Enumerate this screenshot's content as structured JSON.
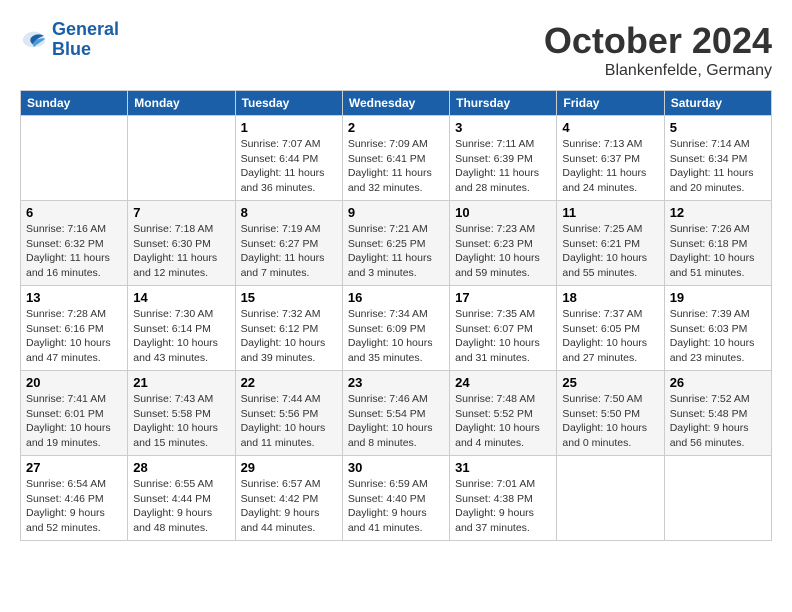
{
  "header": {
    "logo_line1": "General",
    "logo_line2": "Blue",
    "month": "October 2024",
    "location": "Blankenfelde, Germany"
  },
  "weekdays": [
    "Sunday",
    "Monday",
    "Tuesday",
    "Wednesday",
    "Thursday",
    "Friday",
    "Saturday"
  ],
  "weeks": [
    [
      {
        "day": "",
        "sunrise": "",
        "sunset": "",
        "daylight": ""
      },
      {
        "day": "",
        "sunrise": "",
        "sunset": "",
        "daylight": ""
      },
      {
        "day": "1",
        "sunrise": "Sunrise: 7:07 AM",
        "sunset": "Sunset: 6:44 PM",
        "daylight": "Daylight: 11 hours and 36 minutes."
      },
      {
        "day": "2",
        "sunrise": "Sunrise: 7:09 AM",
        "sunset": "Sunset: 6:41 PM",
        "daylight": "Daylight: 11 hours and 32 minutes."
      },
      {
        "day": "3",
        "sunrise": "Sunrise: 7:11 AM",
        "sunset": "Sunset: 6:39 PM",
        "daylight": "Daylight: 11 hours and 28 minutes."
      },
      {
        "day": "4",
        "sunrise": "Sunrise: 7:13 AM",
        "sunset": "Sunset: 6:37 PM",
        "daylight": "Daylight: 11 hours and 24 minutes."
      },
      {
        "day": "5",
        "sunrise": "Sunrise: 7:14 AM",
        "sunset": "Sunset: 6:34 PM",
        "daylight": "Daylight: 11 hours and 20 minutes."
      }
    ],
    [
      {
        "day": "6",
        "sunrise": "Sunrise: 7:16 AM",
        "sunset": "Sunset: 6:32 PM",
        "daylight": "Daylight: 11 hours and 16 minutes."
      },
      {
        "day": "7",
        "sunrise": "Sunrise: 7:18 AM",
        "sunset": "Sunset: 6:30 PM",
        "daylight": "Daylight: 11 hours and 12 minutes."
      },
      {
        "day": "8",
        "sunrise": "Sunrise: 7:19 AM",
        "sunset": "Sunset: 6:27 PM",
        "daylight": "Daylight: 11 hours and 7 minutes."
      },
      {
        "day": "9",
        "sunrise": "Sunrise: 7:21 AM",
        "sunset": "Sunset: 6:25 PM",
        "daylight": "Daylight: 11 hours and 3 minutes."
      },
      {
        "day": "10",
        "sunrise": "Sunrise: 7:23 AM",
        "sunset": "Sunset: 6:23 PM",
        "daylight": "Daylight: 10 hours and 59 minutes."
      },
      {
        "day": "11",
        "sunrise": "Sunrise: 7:25 AM",
        "sunset": "Sunset: 6:21 PM",
        "daylight": "Daylight: 10 hours and 55 minutes."
      },
      {
        "day": "12",
        "sunrise": "Sunrise: 7:26 AM",
        "sunset": "Sunset: 6:18 PM",
        "daylight": "Daylight: 10 hours and 51 minutes."
      }
    ],
    [
      {
        "day": "13",
        "sunrise": "Sunrise: 7:28 AM",
        "sunset": "Sunset: 6:16 PM",
        "daylight": "Daylight: 10 hours and 47 minutes."
      },
      {
        "day": "14",
        "sunrise": "Sunrise: 7:30 AM",
        "sunset": "Sunset: 6:14 PM",
        "daylight": "Daylight: 10 hours and 43 minutes."
      },
      {
        "day": "15",
        "sunrise": "Sunrise: 7:32 AM",
        "sunset": "Sunset: 6:12 PM",
        "daylight": "Daylight: 10 hours and 39 minutes."
      },
      {
        "day": "16",
        "sunrise": "Sunrise: 7:34 AM",
        "sunset": "Sunset: 6:09 PM",
        "daylight": "Daylight: 10 hours and 35 minutes."
      },
      {
        "day": "17",
        "sunrise": "Sunrise: 7:35 AM",
        "sunset": "Sunset: 6:07 PM",
        "daylight": "Daylight: 10 hours and 31 minutes."
      },
      {
        "day": "18",
        "sunrise": "Sunrise: 7:37 AM",
        "sunset": "Sunset: 6:05 PM",
        "daylight": "Daylight: 10 hours and 27 minutes."
      },
      {
        "day": "19",
        "sunrise": "Sunrise: 7:39 AM",
        "sunset": "Sunset: 6:03 PM",
        "daylight": "Daylight: 10 hours and 23 minutes."
      }
    ],
    [
      {
        "day": "20",
        "sunrise": "Sunrise: 7:41 AM",
        "sunset": "Sunset: 6:01 PM",
        "daylight": "Daylight: 10 hours and 19 minutes."
      },
      {
        "day": "21",
        "sunrise": "Sunrise: 7:43 AM",
        "sunset": "Sunset: 5:58 PM",
        "daylight": "Daylight: 10 hours and 15 minutes."
      },
      {
        "day": "22",
        "sunrise": "Sunrise: 7:44 AM",
        "sunset": "Sunset: 5:56 PM",
        "daylight": "Daylight: 10 hours and 11 minutes."
      },
      {
        "day": "23",
        "sunrise": "Sunrise: 7:46 AM",
        "sunset": "Sunset: 5:54 PM",
        "daylight": "Daylight: 10 hours and 8 minutes."
      },
      {
        "day": "24",
        "sunrise": "Sunrise: 7:48 AM",
        "sunset": "Sunset: 5:52 PM",
        "daylight": "Daylight: 10 hours and 4 minutes."
      },
      {
        "day": "25",
        "sunrise": "Sunrise: 7:50 AM",
        "sunset": "Sunset: 5:50 PM",
        "daylight": "Daylight: 10 hours and 0 minutes."
      },
      {
        "day": "26",
        "sunrise": "Sunrise: 7:52 AM",
        "sunset": "Sunset: 5:48 PM",
        "daylight": "Daylight: 9 hours and 56 minutes."
      }
    ],
    [
      {
        "day": "27",
        "sunrise": "Sunrise: 6:54 AM",
        "sunset": "Sunset: 4:46 PM",
        "daylight": "Daylight: 9 hours and 52 minutes."
      },
      {
        "day": "28",
        "sunrise": "Sunrise: 6:55 AM",
        "sunset": "Sunset: 4:44 PM",
        "daylight": "Daylight: 9 hours and 48 minutes."
      },
      {
        "day": "29",
        "sunrise": "Sunrise: 6:57 AM",
        "sunset": "Sunset: 4:42 PM",
        "daylight": "Daylight: 9 hours and 44 minutes."
      },
      {
        "day": "30",
        "sunrise": "Sunrise: 6:59 AM",
        "sunset": "Sunset: 4:40 PM",
        "daylight": "Daylight: 9 hours and 41 minutes."
      },
      {
        "day": "31",
        "sunrise": "Sunrise: 7:01 AM",
        "sunset": "Sunset: 4:38 PM",
        "daylight": "Daylight: 9 hours and 37 minutes."
      },
      {
        "day": "",
        "sunrise": "",
        "sunset": "",
        "daylight": ""
      },
      {
        "day": "",
        "sunrise": "",
        "sunset": "",
        "daylight": ""
      }
    ]
  ]
}
